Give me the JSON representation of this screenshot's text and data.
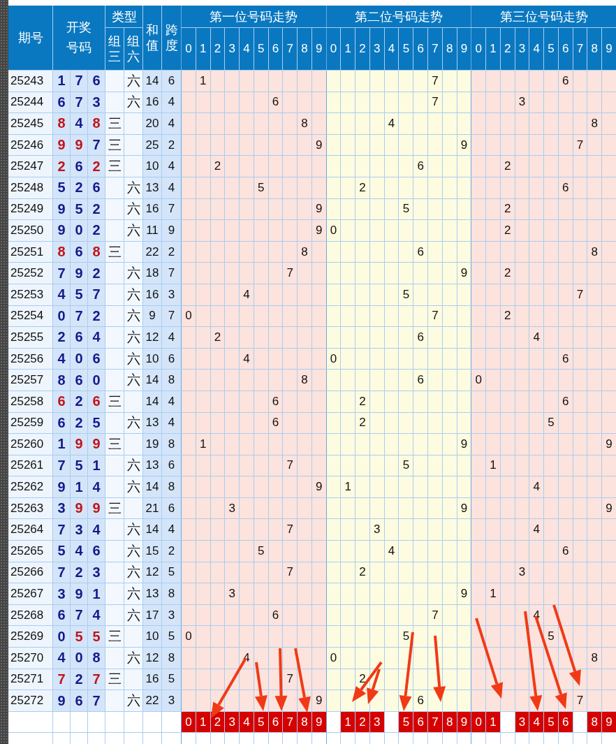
{
  "header": {
    "issue": "期号",
    "draw": "开奖号码",
    "type": "类型",
    "group3": "组三",
    "group6": "组六",
    "sum": "和值",
    "span": "跨度"
  },
  "zones": [
    {
      "title": "第一位号码走势",
      "digits": [
        "0",
        "1",
        "2",
        "3",
        "4",
        "5",
        "6",
        "7",
        "8",
        "9"
      ]
    },
    {
      "title": "第二位号码走势",
      "digits": [
        "0",
        "1",
        "2",
        "3",
        "4",
        "5",
        "6",
        "7",
        "8",
        "9"
      ]
    },
    {
      "title": "第三位号码走势",
      "digits": [
        "0",
        "1",
        "2",
        "3",
        "4",
        "5",
        "6",
        "7",
        "8",
        "9"
      ]
    }
  ],
  "rows": [
    {
      "issue": "25243",
      "draw": [
        "1",
        "7",
        "6"
      ],
      "repeated": [
        false,
        false,
        false
      ],
      "group6": "六",
      "sum": "14",
      "span": "6",
      "trend": [
        "1",
        "7",
        "6"
      ]
    },
    {
      "issue": "25244",
      "draw": [
        "6",
        "7",
        "3"
      ],
      "repeated": [
        false,
        false,
        false
      ],
      "group6": "六",
      "sum": "16",
      "span": "4",
      "trend": [
        "6",
        "7",
        "3"
      ]
    },
    {
      "issue": "25245",
      "draw": [
        "8",
        "4",
        "8"
      ],
      "repeated": [
        true,
        false,
        true
      ],
      "group3": "三",
      "sum": "20",
      "span": "4",
      "trend": [
        "8",
        "4",
        "8"
      ]
    },
    {
      "issue": "25246",
      "draw": [
        "9",
        "9",
        "7"
      ],
      "repeated": [
        true,
        true,
        false
      ],
      "group3": "三",
      "sum": "25",
      "span": "2",
      "trend": [
        "9",
        "9",
        "7"
      ]
    },
    {
      "issue": "25247",
      "draw": [
        "2",
        "6",
        "2"
      ],
      "repeated": [
        true,
        false,
        true
      ],
      "group3": "三",
      "sum": "10",
      "span": "4",
      "trend": [
        "2",
        "6",
        "2"
      ]
    },
    {
      "issue": "25248",
      "draw": [
        "5",
        "2",
        "6"
      ],
      "repeated": [
        false,
        false,
        false
      ],
      "group6": "六",
      "sum": "13",
      "span": "4",
      "trend": [
        "5",
        "2",
        "6"
      ]
    },
    {
      "issue": "25249",
      "draw": [
        "9",
        "5",
        "2"
      ],
      "repeated": [
        false,
        false,
        false
      ],
      "group6": "六",
      "sum": "16",
      "span": "7",
      "trend": [
        "9",
        "5",
        "2"
      ]
    },
    {
      "issue": "25250",
      "draw": [
        "9",
        "0",
        "2"
      ],
      "repeated": [
        false,
        false,
        false
      ],
      "group6": "六",
      "sum": "11",
      "span": "9",
      "trend": [
        "9",
        "0",
        "2"
      ]
    },
    {
      "issue": "25251",
      "draw": [
        "8",
        "6",
        "8"
      ],
      "repeated": [
        true,
        false,
        true
      ],
      "group3": "三",
      "sum": "22",
      "span": "2",
      "trend": [
        "8",
        "6",
        "8"
      ]
    },
    {
      "issue": "25252",
      "draw": [
        "7",
        "9",
        "2"
      ],
      "repeated": [
        false,
        false,
        false
      ],
      "group6": "六",
      "sum": "18",
      "span": "7",
      "trend": [
        "7",
        "9",
        "2"
      ]
    },
    {
      "issue": "25253",
      "draw": [
        "4",
        "5",
        "7"
      ],
      "repeated": [
        false,
        false,
        false
      ],
      "group6": "六",
      "sum": "16",
      "span": "3",
      "trend": [
        "4",
        "5",
        "7"
      ]
    },
    {
      "issue": "25254",
      "draw": [
        "0",
        "7",
        "2"
      ],
      "repeated": [
        false,
        false,
        false
      ],
      "group6": "六",
      "sum": "9",
      "span": "7",
      "trend": [
        "0",
        "7",
        "2"
      ]
    },
    {
      "issue": "25255",
      "draw": [
        "2",
        "6",
        "4"
      ],
      "repeated": [
        false,
        false,
        false
      ],
      "group6": "六",
      "sum": "12",
      "span": "4",
      "trend": [
        "2",
        "6",
        "4"
      ]
    },
    {
      "issue": "25256",
      "draw": [
        "4",
        "0",
        "6"
      ],
      "repeated": [
        false,
        false,
        false
      ],
      "group6": "六",
      "sum": "10",
      "span": "6",
      "trend": [
        "4",
        "0",
        "6"
      ]
    },
    {
      "issue": "25257",
      "draw": [
        "8",
        "6",
        "0"
      ],
      "repeated": [
        false,
        false,
        false
      ],
      "group6": "六",
      "sum": "14",
      "span": "8",
      "trend": [
        "8",
        "6",
        "0"
      ]
    },
    {
      "issue": "25258",
      "draw": [
        "6",
        "2",
        "6"
      ],
      "repeated": [
        true,
        false,
        true
      ],
      "group3": "三",
      "sum": "14",
      "span": "4",
      "trend": [
        "6",
        "2",
        "6"
      ]
    },
    {
      "issue": "25259",
      "draw": [
        "6",
        "2",
        "5"
      ],
      "repeated": [
        false,
        false,
        false
      ],
      "group6": "六",
      "sum": "13",
      "span": "4",
      "trend": [
        "6",
        "2",
        "5"
      ]
    },
    {
      "issue": "25260",
      "draw": [
        "1",
        "9",
        "9"
      ],
      "repeated": [
        false,
        true,
        true
      ],
      "group3": "三",
      "sum": "19",
      "span": "8",
      "trend": [
        "1",
        "9",
        "9"
      ]
    },
    {
      "issue": "25261",
      "draw": [
        "7",
        "5",
        "1"
      ],
      "repeated": [
        false,
        false,
        false
      ],
      "group6": "六",
      "sum": "13",
      "span": "6",
      "trend": [
        "7",
        "5",
        "1"
      ]
    },
    {
      "issue": "25262",
      "draw": [
        "9",
        "1",
        "4"
      ],
      "repeated": [
        false,
        false,
        false
      ],
      "group6": "六",
      "sum": "14",
      "span": "8",
      "trend": [
        "9",
        "1",
        "4"
      ]
    },
    {
      "issue": "25263",
      "draw": [
        "3",
        "9",
        "9"
      ],
      "repeated": [
        false,
        true,
        true
      ],
      "group3": "三",
      "sum": "21",
      "span": "6",
      "trend": [
        "3",
        "9",
        "9"
      ]
    },
    {
      "issue": "25264",
      "draw": [
        "7",
        "3",
        "4"
      ],
      "repeated": [
        false,
        false,
        false
      ],
      "group6": "六",
      "sum": "14",
      "span": "4",
      "trend": [
        "7",
        "3",
        "4"
      ]
    },
    {
      "issue": "25265",
      "draw": [
        "5",
        "4",
        "6"
      ],
      "repeated": [
        false,
        false,
        false
      ],
      "group6": "六",
      "sum": "15",
      "span": "2",
      "trend": [
        "5",
        "4",
        "6"
      ]
    },
    {
      "issue": "25266",
      "draw": [
        "7",
        "2",
        "3"
      ],
      "repeated": [
        false,
        false,
        false
      ],
      "group6": "六",
      "sum": "12",
      "span": "5",
      "trend": [
        "7",
        "2",
        "3"
      ]
    },
    {
      "issue": "25267",
      "draw": [
        "3",
        "9",
        "1"
      ],
      "repeated": [
        false,
        false,
        false
      ],
      "group6": "六",
      "sum": "13",
      "span": "8",
      "trend": [
        "3",
        "9",
        "1"
      ]
    },
    {
      "issue": "25268",
      "draw": [
        "6",
        "7",
        "4"
      ],
      "repeated": [
        false,
        false,
        false
      ],
      "group6": "六",
      "sum": "17",
      "span": "3",
      "trend": [
        "6",
        "7",
        "4"
      ]
    },
    {
      "issue": "25269",
      "draw": [
        "0",
        "5",
        "5"
      ],
      "repeated": [
        false,
        true,
        true
      ],
      "group3": "三",
      "sum": "10",
      "span": "5",
      "trend": [
        "0",
        "5",
        "5"
      ]
    },
    {
      "issue": "25270",
      "draw": [
        "4",
        "0",
        "8"
      ],
      "repeated": [
        false,
        false,
        false
      ],
      "group6": "六",
      "sum": "12",
      "span": "8",
      "trend": [
        "4",
        "0",
        "8"
      ]
    },
    {
      "issue": "25271",
      "draw": [
        "7",
        "2",
        "7"
      ],
      "repeated": [
        true,
        false,
        true
      ],
      "group3": "三",
      "sum": "16",
      "span": "5",
      "trend": [
        "7",
        "2"
      ]
    },
    {
      "issue": "25272",
      "draw": [
        "9",
        "6",
        "7"
      ],
      "repeated": [
        false,
        false,
        false
      ],
      "group6": "六",
      "sum": "22",
      "span": "3",
      "trend": [
        "9",
        "6",
        "7"
      ]
    }
  ],
  "summary": [
    {
      "marked": true,
      "text": "0"
    },
    {
      "marked": true,
      "text": "1"
    },
    {
      "marked": true,
      "text": "2"
    },
    {
      "marked": true,
      "text": "3"
    },
    {
      "marked": true,
      "text": "4"
    },
    {
      "marked": true,
      "text": "5"
    },
    {
      "marked": true,
      "text": "6"
    },
    {
      "marked": true,
      "text": "7"
    },
    {
      "marked": true,
      "text": "8"
    },
    {
      "marked": true,
      "text": "9"
    },
    {
      "marked": false
    },
    {
      "marked": true,
      "text": "1"
    },
    {
      "marked": true,
      "text": "2"
    },
    {
      "marked": true,
      "text": "3"
    },
    {
      "marked": false
    },
    {
      "marked": true,
      "text": "5"
    },
    {
      "marked": true,
      "text": "6"
    },
    {
      "marked": true,
      "text": "7"
    },
    {
      "marked": true,
      "text": "8"
    },
    {
      "marked": true,
      "text": "9"
    },
    {
      "marked": true,
      "text": "0"
    },
    {
      "marked": true,
      "text": "1"
    },
    {
      "marked": false
    },
    {
      "marked": true,
      "text": "3"
    },
    {
      "marked": true,
      "text": "4"
    },
    {
      "marked": true,
      "text": "5"
    },
    {
      "marked": true,
      "text": "6"
    },
    {
      "marked": false
    },
    {
      "marked": true,
      "text": "8"
    },
    {
      "marked": true,
      "text": "9"
    }
  ]
}
